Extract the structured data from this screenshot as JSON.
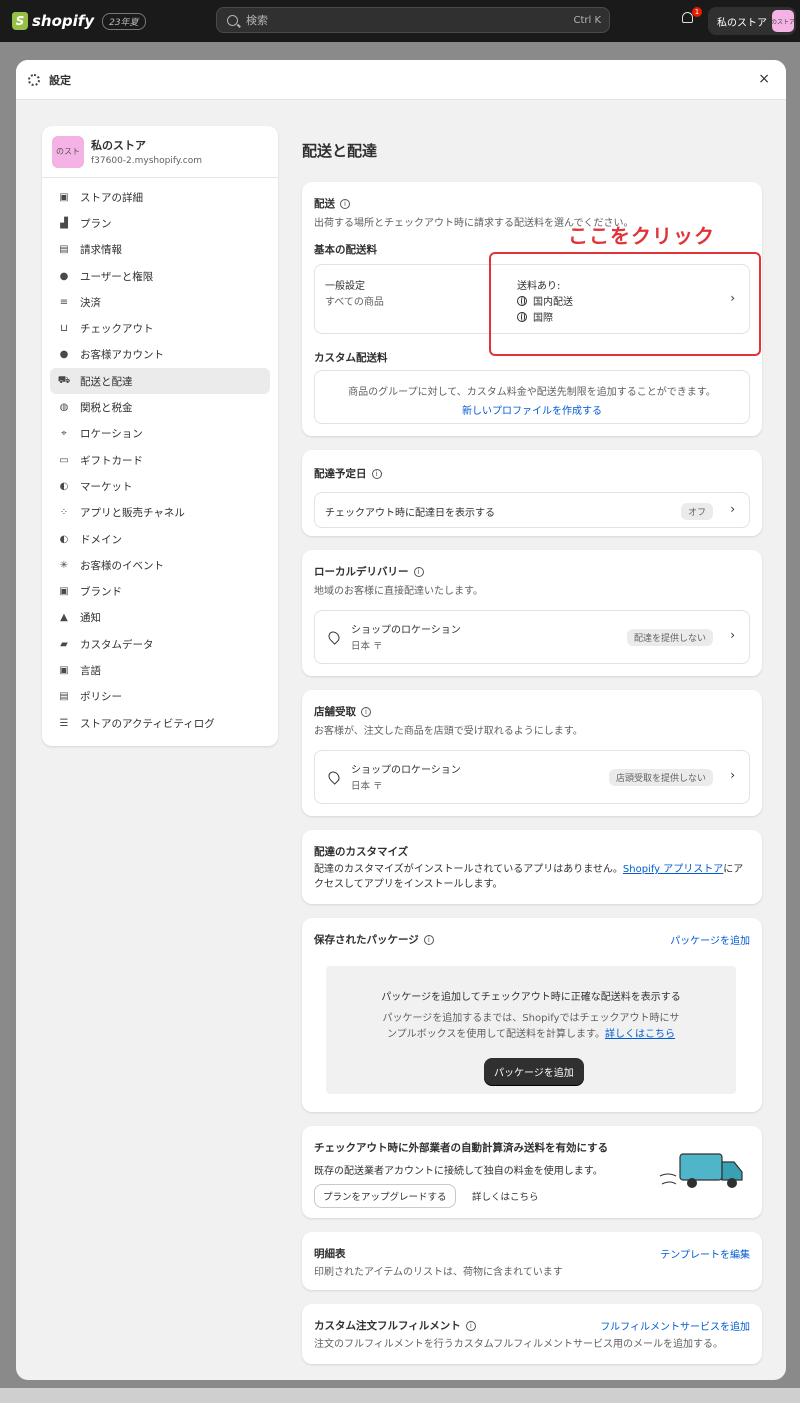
{
  "topbar": {
    "logo_mark": "S",
    "logo_text": "shopify",
    "edition_badge": "23年夏",
    "search_placeholder": "検索",
    "search_shortcut": "Ctrl K",
    "notification_count": "1",
    "store_button_label": "私のストア",
    "store_avatar_text": "のストア"
  },
  "modal": {
    "title": "設定",
    "close": "×"
  },
  "sidebar": {
    "store_name": "私のストア",
    "store_domain": "f37600-2.myshopify.com",
    "store_avatar_text": "のスト",
    "items": [
      {
        "label": "ストアの詳細",
        "icon": "store-icon"
      },
      {
        "label": "プラン",
        "icon": "plan-icon"
      },
      {
        "label": "請求情報",
        "icon": "billing-icon"
      },
      {
        "label": "ユーザーと権限",
        "icon": "users-icon"
      },
      {
        "label": "決済",
        "icon": "payments-icon"
      },
      {
        "label": "チェックアウト",
        "icon": "cart-icon"
      },
      {
        "label": "お客様アカウント",
        "icon": "person-icon"
      },
      {
        "label": "配送と配達",
        "icon": "truck-icon",
        "active": true
      },
      {
        "label": "関税と税金",
        "icon": "tax-icon"
      },
      {
        "label": "ロケーション",
        "icon": "location-icon"
      },
      {
        "label": "ギフトカード",
        "icon": "gift-card-icon"
      },
      {
        "label": "マーケット",
        "icon": "globe-icon"
      },
      {
        "label": "アプリと販売チャネル",
        "icon": "apps-icon"
      },
      {
        "label": "ドメイン",
        "icon": "domain-icon"
      },
      {
        "label": "お客様のイベント",
        "icon": "events-icon"
      },
      {
        "label": "ブランド",
        "icon": "brand-icon"
      },
      {
        "label": "通知",
        "icon": "bell-icon"
      },
      {
        "label": "カスタムデータ",
        "icon": "data-icon"
      },
      {
        "label": "言語",
        "icon": "language-icon"
      },
      {
        "label": "ポリシー",
        "icon": "policy-icon"
      },
      {
        "label": "ストアのアクティビティログ",
        "icon": "list-icon"
      }
    ]
  },
  "main": {
    "page_title": "配送と配達",
    "annotation": "ここをクリック",
    "shipping": {
      "title": "配送",
      "desc": "出荷する場所とチェックアウト時に請求する配送料を選んでください。",
      "basic_rates_label": "基本の配送料",
      "general_title": "一般設定",
      "general_sub": "すべての商品",
      "rates_label": "送料あり:",
      "zone_domestic": "国内配送",
      "zone_international": "国際",
      "custom_rates_label": "カスタム配送料",
      "custom_desc": "商品のグループに対して、カスタム料金や配送先制限を追加することができます。",
      "create_profile": "新しいプロファイルを作成する"
    },
    "delivery_date": {
      "title": "配達予定日",
      "row_label": "チェックアウト時に配達日を表示する",
      "status": "オフ"
    },
    "local_delivery": {
      "title": "ローカルデリバリー",
      "desc": "地域のお客様に直接配達いたします。",
      "location": "ショップのロケーション",
      "country": "日本 〒",
      "status": "配達を提供しない"
    },
    "pickup": {
      "title": "店舗受取",
      "desc": "お客様が、注文した商品を店頭で受け取れるようにします。",
      "location": "ショップのロケーション",
      "country": "日本 〒",
      "status": "店頭受取を提供しない"
    },
    "customization": {
      "title": "配達のカスタマイズ",
      "desc_before": "配達のカスタマイズがインストールされているアプリはありません。",
      "desc_link": "Shopify アプリストア",
      "desc_after": "にアクセスしてアプリをインストールします。"
    },
    "packages": {
      "title": "保存されたパッケージ",
      "add_link": "パッケージを追加",
      "empty_title": "パッケージを追加してチェックアウト時に正確な配送料を表示する",
      "empty_desc": "パッケージを追加するまでは、Shopifyではチェックアウト時にサンプルボックスを使用して配送料を計算します。",
      "learn_more": "詳しくはこちら",
      "add_button": "パッケージを追加"
    },
    "carrier": {
      "title": "チェックアウト時に外部業者の自動計算済み送料を有効にする",
      "desc": "既存の配送業者アカウントに接続して独自の料金を使用します。",
      "upgrade_button": "プランをアップグレードする",
      "learn_more": "詳しくはこちら"
    },
    "packing_slip": {
      "title": "明細表",
      "desc": "印刷されたアイテムのリストは、荷物に含まれています",
      "edit_link": "テンプレートを編集"
    },
    "custom_fulfillment": {
      "title": "カスタム注文フルフィルメント",
      "desc": "注文のフルフィルメントを行うカスタムフルフィルメントサービス用のメールを追加する。",
      "add_link": "フルフィルメントサービスを追加"
    }
  },
  "colors": {
    "accent_link": "#005bd3",
    "annotation_red": "#e0343a",
    "topbar": "#1a1a1a",
    "store_avatar": "#f5b2e5"
  }
}
